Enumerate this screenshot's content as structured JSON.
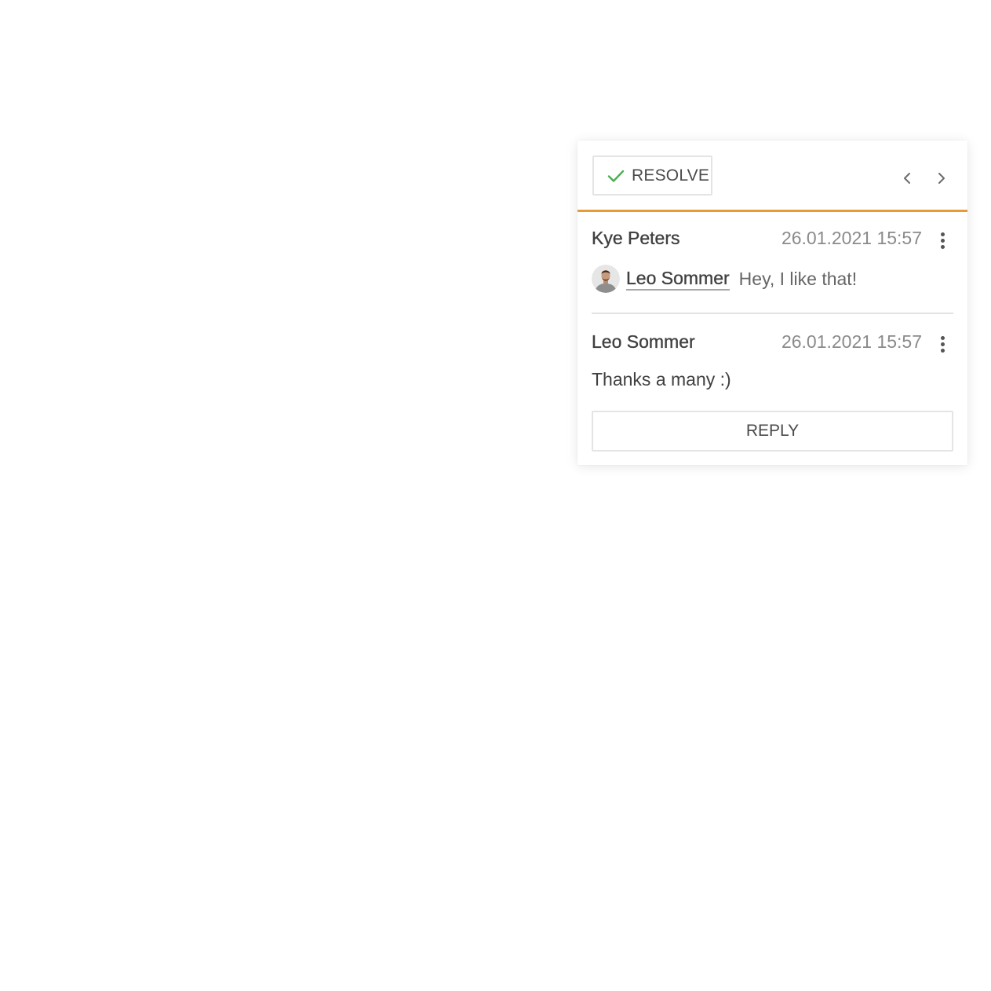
{
  "toolbar": {
    "resolve_label": "RESOLVE",
    "accent_color": "#e69b37",
    "check_color": "#4caf50"
  },
  "comments": [
    {
      "author": "Kye Peters",
      "timestamp": "26.01.2021 15:57",
      "mention": "Leo Sommer",
      "text": "Hey, I like that!"
    },
    {
      "author": "Leo Sommer",
      "timestamp": "26.01.2021 15:57",
      "text": "Thanks a many :)"
    }
  ],
  "reply": {
    "label": "REPLY"
  },
  "icons": {
    "resolve": "check-icon",
    "previous": "chevron-left-icon",
    "next": "chevron-right-icon",
    "more": "more-vertical-icon"
  }
}
